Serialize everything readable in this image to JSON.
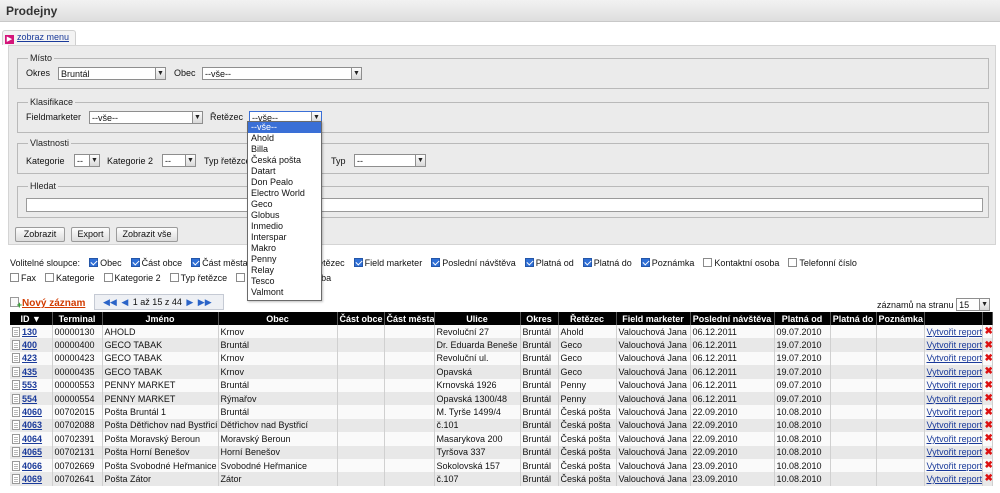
{
  "app": {
    "title": "Prodejny",
    "menu_link": "zobraz menu"
  },
  "filters": {
    "misto": {
      "legend": "Místo",
      "okres_label": "Okres",
      "okres_value": "Bruntál",
      "obec_label": "Obec",
      "obec_value": "--vše--"
    },
    "klasifikace": {
      "legend": "Klasifikace",
      "fieldmarketer_label": "Fieldmarketer",
      "fieldmarketer_value": "--vše--",
      "retezec_label": "Řetězec",
      "retezec_value": "--vše--"
    },
    "vlastnosti": {
      "legend": "Vlastnosti",
      "kategorie_label": "Kategorie",
      "kategorie_value": "--",
      "kategorie2_label": "Kategorie 2",
      "kategorie2_value": "--",
      "typ_retezce_label": "Typ řetězce",
      "typ_label": "Typ",
      "typ_value": "--"
    },
    "hledat": {
      "legend": "Hledat",
      "value": ""
    },
    "buttons": {
      "zobrazit": "Zobrazit",
      "export": "Export",
      "zobrazit_vse": "Zobrazit vše"
    }
  },
  "retezec_dropdown": {
    "options": [
      "--vše--",
      "Ahold",
      "Billa",
      "Česká pošta",
      "Datart",
      "Don Pealo",
      "Electro World",
      "Geco",
      "Globus",
      "Inmedio",
      "Interspar",
      "Makro",
      "Penny",
      "Relay",
      "Tesco",
      "Valmont"
    ],
    "selected_index": 0
  },
  "optional_columns": {
    "label": "Volitelné sloupce:",
    "row1": [
      {
        "label": "Obec",
        "checked": true
      },
      {
        "label": "Část obce",
        "checked": true
      },
      {
        "label": "Část města",
        "checked": true
      },
      {
        "label": "Okres",
        "checked": true
      },
      {
        "label": "Řetězec",
        "checked": true
      },
      {
        "label": "Field marketer",
        "checked": true
      },
      {
        "label": "Poslední návštěva",
        "checked": true
      },
      {
        "label": "Platná od",
        "checked": true
      },
      {
        "label": "Platná do",
        "checked": true
      },
      {
        "label": "Poznámka",
        "checked": true
      },
      {
        "label": "Kontaktní osoba",
        "checked": false
      },
      {
        "label": "Telefonní číslo",
        "checked": false
      }
    ],
    "row2": [
      {
        "label": "Fax",
        "checked": false
      },
      {
        "label": "Kategorie",
        "checked": false
      },
      {
        "label": "Kategorie 2",
        "checked": false
      },
      {
        "label": "Typ řetězce",
        "checked": false
      },
      {
        "label": "d",
        "checked": false
      },
      {
        "label": "Otevírací doba",
        "checked": false
      }
    ]
  },
  "toolbar": {
    "new_record": "Nový záznam",
    "pager_text": "1 až 15 z 44",
    "per_page_label": "záznamů na stranu",
    "per_page_value": "15"
  },
  "table": {
    "headers": [
      "ID",
      "Terminal",
      "Jméno",
      "Obec",
      "Část obce",
      "Část města",
      "Ulice",
      "Okres",
      "Řetězec",
      "Field marketer",
      "Poslední návštěva",
      "Platná od",
      "Platná do",
      "Poznámka",
      "",
      ""
    ],
    "report_label": "Vytvořit report",
    "rows": [
      {
        "id": "130",
        "terminal": "00000130",
        "jmeno": "AHOLD",
        "obec": "Krnov",
        "cast_obce": "",
        "cast_mesta": "",
        "ulice": "Revoluční 27",
        "okres": "Bruntál",
        "retezec": "Ahold",
        "fm": "Valouchová Jana",
        "posledni": "06.12.2011",
        "od": "09.07.2010",
        "do": "",
        "poznamka": ""
      },
      {
        "id": "400",
        "terminal": "00000400",
        "jmeno": "GECO TABAK",
        "obec": "Bruntál",
        "cast_obce": "",
        "cast_mesta": "",
        "ulice": "Dr. Eduarda Beneše",
        "okres": "Bruntál",
        "retezec": "Geco",
        "fm": "Valouchová Jana",
        "posledni": "06.12.2011",
        "od": "19.07.2010",
        "do": "",
        "poznamka": ""
      },
      {
        "id": "423",
        "terminal": "00000423",
        "jmeno": "GECO TABAK",
        "obec": "Krnov",
        "cast_obce": "",
        "cast_mesta": "",
        "ulice": "Revoluční ul.",
        "okres": "Bruntál",
        "retezec": "Geco",
        "fm": "Valouchová Jana",
        "posledni": "06.12.2011",
        "od": "19.07.2010",
        "do": "",
        "poznamka": ""
      },
      {
        "id": "435",
        "terminal": "00000435",
        "jmeno": "GECO TABAK",
        "obec": "Krnov",
        "cast_obce": "",
        "cast_mesta": "",
        "ulice": "Opavská",
        "okres": "Bruntál",
        "retezec": "Geco",
        "fm": "Valouchová Jana",
        "posledni": "06.12.2011",
        "od": "19.07.2010",
        "do": "",
        "poznamka": ""
      },
      {
        "id": "553",
        "terminal": "00000553",
        "jmeno": "PENNY MARKET",
        "obec": "Bruntál",
        "cast_obce": "",
        "cast_mesta": "",
        "ulice": "Krnovská 1926",
        "okres": "Bruntál",
        "retezec": "Penny",
        "fm": "Valouchová Jana",
        "posledni": "06.12.2011",
        "od": "09.07.2010",
        "do": "",
        "poznamka": ""
      },
      {
        "id": "554",
        "terminal": "00000554",
        "jmeno": "PENNY MARKET",
        "obec": "Rýmařov",
        "cast_obce": "",
        "cast_mesta": "",
        "ulice": "Opavská 1300/48",
        "okres": "Bruntál",
        "retezec": "Penny",
        "fm": "Valouchová Jana",
        "posledni": "06.12.2011",
        "od": "09.07.2010",
        "do": "",
        "poznamka": ""
      },
      {
        "id": "4060",
        "terminal": "00702015",
        "jmeno": "Pošta Bruntál 1",
        "obec": "Bruntál",
        "cast_obce": "",
        "cast_mesta": "",
        "ulice": "M. Tyrše 1499/4",
        "okres": "Bruntál",
        "retezec": "Česká pošta",
        "fm": "Valouchová Jana",
        "posledni": "22.09.2010",
        "od": "10.08.2010",
        "do": "",
        "poznamka": ""
      },
      {
        "id": "4063",
        "terminal": "00702088",
        "jmeno": "Pošta Dětřichov nad Bystřicí",
        "obec": "Dětřichov nad Bystřicí",
        "cast_obce": "",
        "cast_mesta": "",
        "ulice": "č.101",
        "okres": "Bruntál",
        "retezec": "Česká pošta",
        "fm": "Valouchová Jana",
        "posledni": "22.09.2010",
        "od": "10.08.2010",
        "do": "",
        "poznamka": ""
      },
      {
        "id": "4064",
        "terminal": "00702391",
        "jmeno": "Pošta Moravský Beroun",
        "obec": "Moravský Beroun",
        "cast_obce": "",
        "cast_mesta": "",
        "ulice": "Masarykova 200",
        "okres": "Bruntál",
        "retezec": "Česká pošta",
        "fm": "Valouchová Jana",
        "posledni": "22.09.2010",
        "od": "10.08.2010",
        "do": "",
        "poznamka": ""
      },
      {
        "id": "4065",
        "terminal": "00702131",
        "jmeno": "Pošta Horní Benešov",
        "obec": "Horní Benešov",
        "cast_obce": "",
        "cast_mesta": "",
        "ulice": "Tyršova 337",
        "okres": "Bruntál",
        "retezec": "Česká pošta",
        "fm": "Valouchová Jana",
        "posledni": "22.09.2010",
        "od": "10.08.2010",
        "do": "",
        "poznamka": ""
      },
      {
        "id": "4066",
        "terminal": "00702669",
        "jmeno": "Pošta Svobodné Heřmanice",
        "obec": "Svobodné Heřmanice",
        "cast_obce": "",
        "cast_mesta": "",
        "ulice": "Sokolovská 157",
        "okres": "Bruntál",
        "retezec": "Česká pošta",
        "fm": "Valouchová Jana",
        "posledni": "23.09.2010",
        "od": "10.08.2010",
        "do": "",
        "poznamka": ""
      },
      {
        "id": "4069",
        "terminal": "00702641",
        "jmeno": "Pošta Zátor",
        "obec": "Zátor",
        "cast_obce": "",
        "cast_mesta": "",
        "ulice": "č.107",
        "okres": "Bruntál",
        "retezec": "Česká pošta",
        "fm": "Valouchová Jana",
        "posledni": "23.09.2010",
        "od": "10.08.2010",
        "do": "",
        "poznamka": ""
      }
    ]
  },
  "colors": {
    "header_bg": "#000000",
    "link": "#1a3a9a",
    "new_record": "#d23b00",
    "delete": "#dd1111",
    "checkbox": "#2f6fd6"
  }
}
